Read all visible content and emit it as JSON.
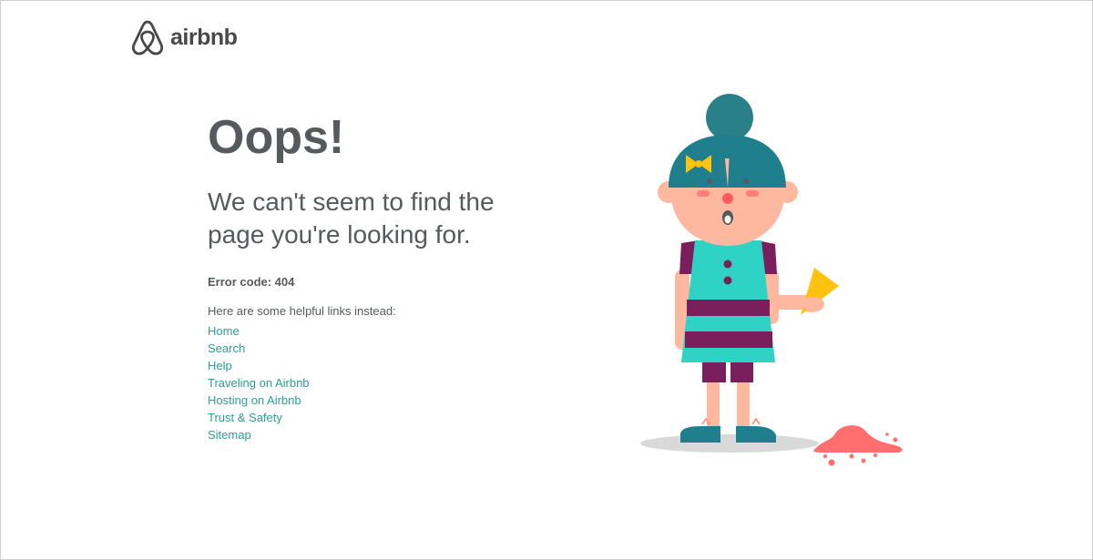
{
  "brand": {
    "name": "airbnb",
    "logo_icon": "airbnb-belo-icon",
    "color": "#484848"
  },
  "main": {
    "headline": "Oops!",
    "subheadline": "We can't seem to find the page you're looking for.",
    "error_code": "Error code: 404",
    "links_intro": "Here are some helpful links instead:",
    "links": [
      {
        "label": "Home"
      },
      {
        "label": "Search"
      },
      {
        "label": "Help"
      },
      {
        "label": "Traveling on Airbnb"
      },
      {
        "label": "Hosting on Airbnb"
      },
      {
        "label": "Trust & Safety"
      },
      {
        "label": "Sitemap"
      }
    ]
  },
  "illustration": {
    "subject": "girl-dropped-ice-cream-illustration",
    "colors": {
      "hair": "#1f7f8c",
      "skin": "#ffb8a0",
      "dress": "#2fd3c6",
      "stripes": "#7b1f5c",
      "cone": "#ffc20e",
      "ice_cream": "#ff6f6f",
      "shadow": "#d9d9d9"
    }
  },
  "colors": {
    "link": "#2a9d96",
    "text": "#565a5c",
    "border": "#cfcfcf"
  }
}
